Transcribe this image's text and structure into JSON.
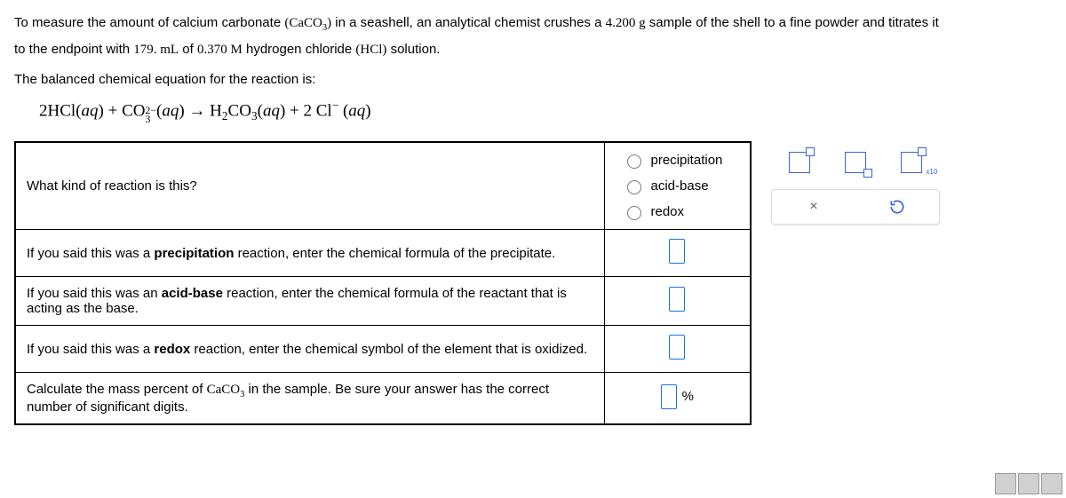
{
  "intro": {
    "p1a": "To measure the amount of calcium carbonate ",
    "caco3": "CaCO",
    "p1b": " in a seashell, an analytical chemist crushes a ",
    "mass": "4.200 g",
    "p1c": " sample of the shell to a fine powder and titrates it",
    "p2a": "to the endpoint with ",
    "vol": "179. mL",
    "p2b": " of ",
    "conc": "0.370 M",
    "p2c": " hydrogen chloride ",
    "hcl": "HCl",
    "p2d": " solution.",
    "p3": "The balanced chemical equation for the reaction is:"
  },
  "equation": {
    "lhs1": "2HCl",
    "aq": "aq",
    "plus": " + ",
    "co3": "CO",
    "arrow": "  →  ",
    "h2co3a": "H",
    "h2co3b": "CO",
    "plus2": " + 2 Cl",
    "minus": "−"
  },
  "q1": {
    "prompt": "What kind of reaction is this?",
    "opt1": "precipitation",
    "opt2": "acid-base",
    "opt3": "redox"
  },
  "q2": {
    "a": "If you said this was a ",
    "b": "precipitation",
    "c": " reaction, enter the chemical formula of the precipitate."
  },
  "q3": {
    "a": "If you said this was an ",
    "b": "acid-base",
    "c": " reaction, enter the chemical formula of the reactant that is acting as the base."
  },
  "q4": {
    "a": "If you said this was a ",
    "b": "redox",
    "c": " reaction, enter the chemical symbol of the element that is oxidized."
  },
  "q5": {
    "a": "Calculate the mass percent of ",
    "b": "CaCO",
    "c": " in the sample. Be sure your answer has the correct number of significant digits.",
    "pct": "%"
  },
  "tools": {
    "x10": "x10",
    "times": "×",
    "reset": "↺"
  }
}
